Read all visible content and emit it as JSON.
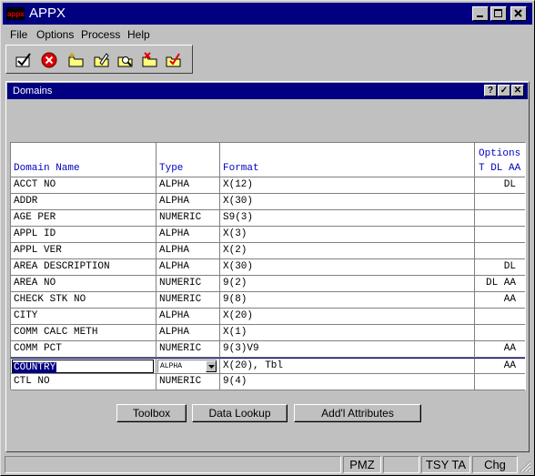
{
  "app": {
    "title": "APPX",
    "minimize_label": "_",
    "maximize_label": "□",
    "close_label": "✕"
  },
  "menu": [
    {
      "label": "File"
    },
    {
      "label": "Options"
    },
    {
      "label": "Process"
    },
    {
      "label": "Help"
    }
  ],
  "toolbar": {
    "icons": [
      "check-icon",
      "cancel-icon",
      "new-folder-icon",
      "edit-folder-icon",
      "search-folder-icon",
      "delete-folder-icon",
      "mark-folder-icon"
    ]
  },
  "child": {
    "title": "Domains",
    "help_label": "?",
    "ok_label": "✓",
    "close_label": "✕"
  },
  "grid": {
    "headers": {
      "name": "Domain Name",
      "type": "Type",
      "format": "Format",
      "options": "Options",
      "options_sub": "T DL AA"
    },
    "rows": [
      {
        "name": "ACCT NO",
        "type": "ALPHA",
        "format": "X(12)",
        "options": "DL"
      },
      {
        "name": "ADDR",
        "type": "ALPHA",
        "format": "X(30)",
        "options": ""
      },
      {
        "name": "AGE PER",
        "type": "NUMERIC",
        "format": "S9(3)",
        "options": ""
      },
      {
        "name": "APPL ID",
        "type": "ALPHA",
        "format": "X(3)",
        "options": ""
      },
      {
        "name": "APPL VER",
        "type": "ALPHA",
        "format": "X(2)",
        "options": ""
      },
      {
        "name": "AREA DESCRIPTION",
        "type": "ALPHA",
        "format": "X(30)",
        "options": "DL"
      },
      {
        "name": "AREA NO",
        "type": "NUMERIC",
        "format": "9(2)",
        "options": "DL AA"
      },
      {
        "name": "CHECK STK NO",
        "type": "NUMERIC",
        "format": "9(8)",
        "options": "AA"
      },
      {
        "name": "CITY",
        "type": "ALPHA",
        "format": "X(20)",
        "options": ""
      },
      {
        "name": "COMM CALC METH",
        "type": "ALPHA",
        "format": "X(1)",
        "options": ""
      },
      {
        "name": "COMM PCT",
        "type": "NUMERIC",
        "format": "9(3)V9",
        "options": "AA"
      },
      {
        "name": "COUNTRY",
        "type": "ALPHA",
        "format": "X(20), Tbl",
        "options": "AA",
        "current": true
      },
      {
        "name": "CTL NO",
        "type": "NUMERIC",
        "format": "9(4)",
        "options": ""
      }
    ]
  },
  "buttons": {
    "toolbox": "Toolbox",
    "data_lookup": "Data Lookup",
    "add_attributes": "Add'l Attributes"
  },
  "status": {
    "pmz": "PMZ",
    "tsy": "TSY TA",
    "mode": "Chg"
  },
  "colors": {
    "title_bg": "#000080",
    "header_text": "#0000c0",
    "face": "#c0c0c0"
  }
}
